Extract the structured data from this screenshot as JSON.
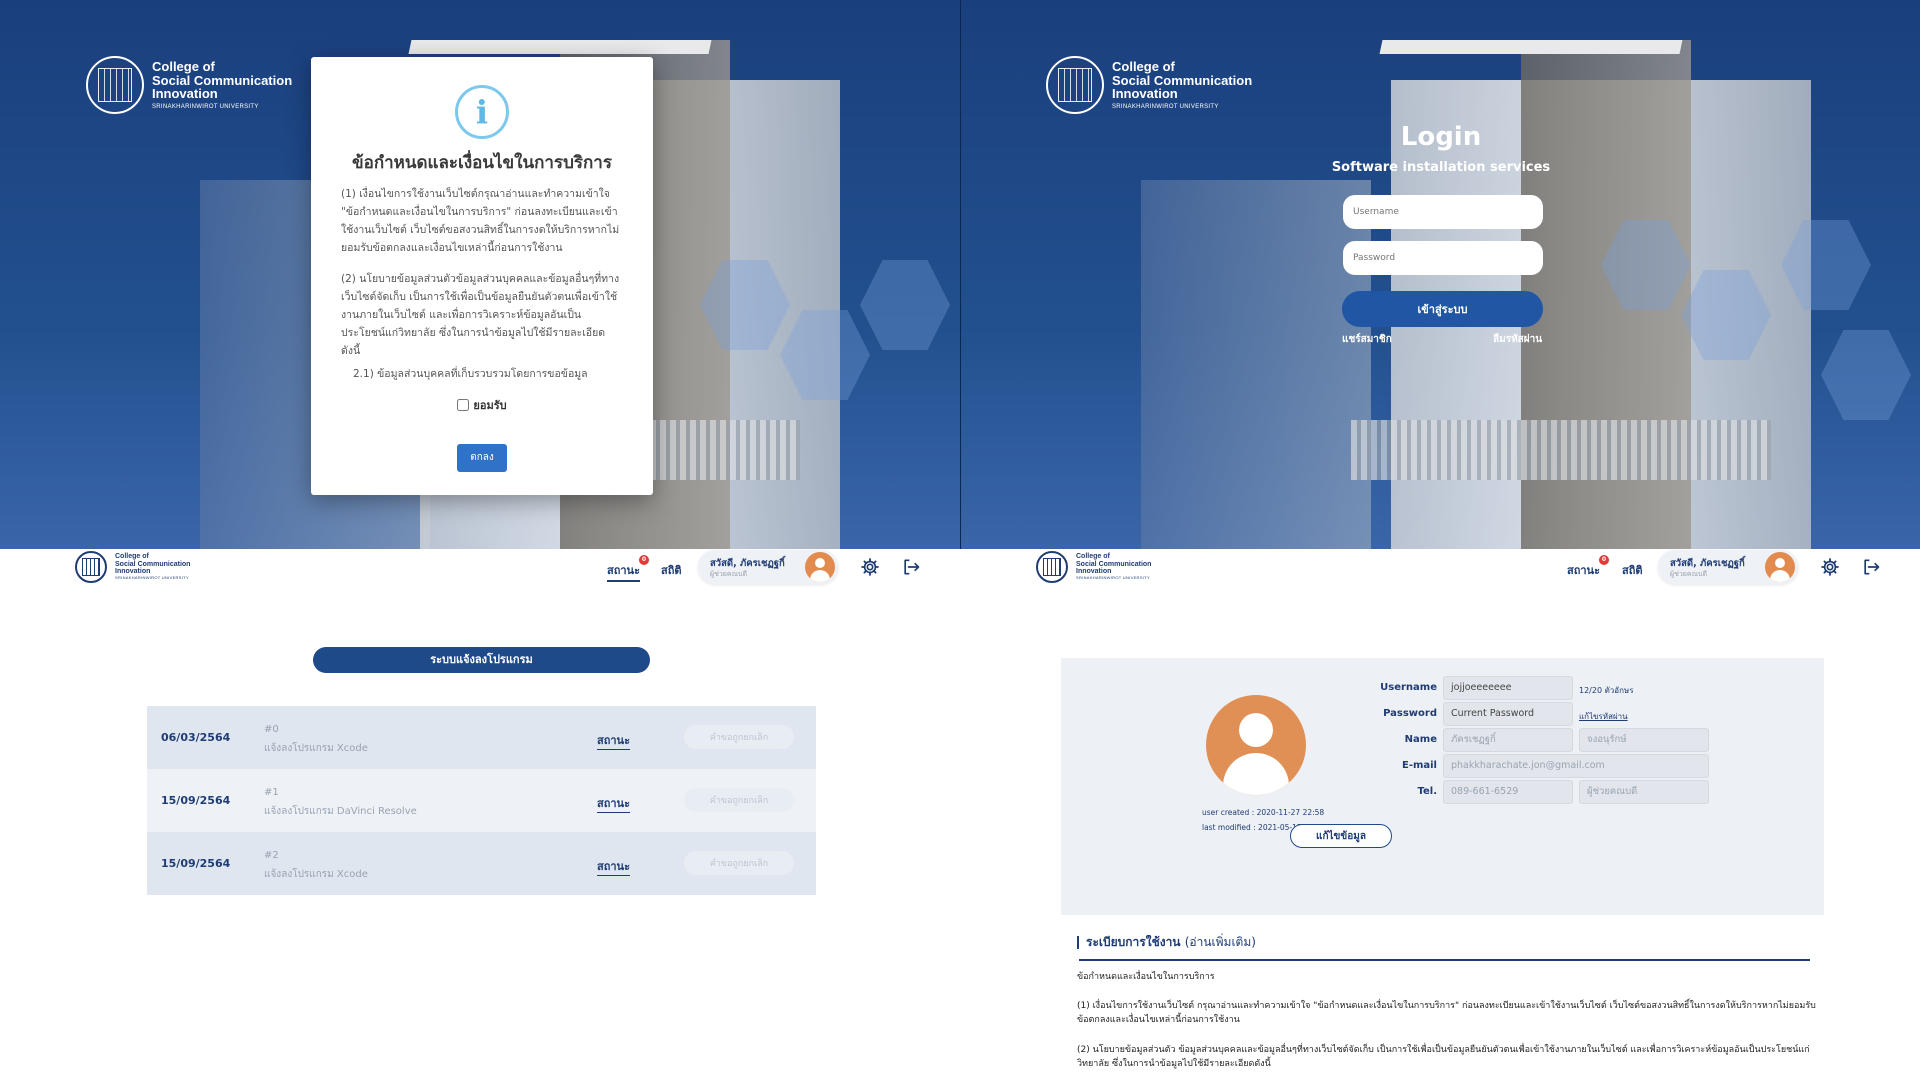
{
  "logo": {
    "title_line1": "College of",
    "title_line2": "Social Communication",
    "title_line3": "Innovation",
    "university": "SRINAKHARINWIROT UNIVERSITY"
  },
  "terms_modal": {
    "title": "ข้อกำหนดและเงื่อนไขในการบริการ",
    "para1": "(1)    เงื่อนไขการใช้งานเว็บไซต์กรุณาอ่านและทำความเข้าใจ \"ข้อกำหนดและเงื่อนไขในการบริการ\" ก่อนลงทะเบียนและเข้าใช้งานเว็บไซต์ เว็บไซต์ขอสงวนสิทธิ์ในการงดให้บริการหากไม่ยอมรับข้อตกลงและเงื่อนไขเหล่านี้ก่อนการใช้งาน",
    "para2": "(2)    นโยบายข้อมูลส่วนตัวข้อมูลส่วนบุคคลและข้อมูลอื่นๆที่ทางเว็บไซต์จัดเก็บ เป็นการใช้เพื่อเป็นข้อมูลยืนยันตัวตนเพื่อเข้าใช้งานภายในเว็บไซต์ และเพื่อการวิเคราะห์ข้อมูลอันเป็นประโยชน์แก่วิทยาลัย ซึ่งในการนำข้อมูลไปใช้มีรายละเอียดดังนี้",
    "para3": "2.1)    ข้อมูลส่วนบุคคลที่เก็บรวบรวมโดยการขอข้อมูล",
    "accept_label": "ยอมรับ",
    "ok_label": "ตกลง"
  },
  "login": {
    "title": "Login",
    "subtitle": "Software installation services",
    "username_placeholder": "Username",
    "password_placeholder": "Password",
    "submit_label": "เข้าสู่ระบบ",
    "register_link": "แชร์สมาชิก",
    "forgot_link": "ลืมรหัสผ่าน"
  },
  "navbar": {
    "status_label": "สถานะ",
    "status_badge": "0",
    "stats_label": "สถิติ",
    "user_name": "สวัสดี, ภัครเชฏฐกิ์",
    "user_role": "ผู้ช่วยคณบดี"
  },
  "requests": {
    "section_title": "ระบบแจ้งลงโปรแกรม",
    "status_label": "สถานะ",
    "cancel_label": "คำขอถูกยกเลิก",
    "rows": [
      {
        "date": "06/03/2564",
        "id": "#0",
        "desc": "แจ้งลงโปรแกรม Xcode"
      },
      {
        "date": "15/09/2564",
        "id": "#1",
        "desc": "แจ้งลงโปรแกรม DaVinci Resolve"
      },
      {
        "date": "15/09/2564",
        "id": "#2",
        "desc": "แจ้งลงโปรแกรม Xcode"
      }
    ]
  },
  "profile": {
    "user_created": "user created : 2020-11-27 22:58",
    "last_modified": "last modified : 2021-05-15 19:31",
    "username_label": "Username",
    "username_value": "jojjoeeeeeee",
    "username_count": "12/20 ตัวอักษร",
    "password_label": "Password",
    "password_placeholder": "Current Password",
    "password_link": "แก้ไขรหัสผ่าน",
    "name_label": "Name",
    "first_name": "ภัครเชฏฐกิ์",
    "last_name": "จงอนุรักษ์",
    "email_label": "E-mail",
    "email_value": "phakkharachate.jon@gmail.com",
    "tel_label": "Tel.",
    "tel_value": "089-661-6529",
    "position_value": "ผู้ช่วยคณบดี",
    "edit_label": "แก้ไขข้อมูล"
  },
  "rules": {
    "title": "ระเบียบการใช้งาน",
    "more": "(อ่านเพิ่มเติม)",
    "heading": "ข้อกำหนดและเงื่อนไขในการบริการ",
    "para1": "(1)    เงื่อนไขการใช้งานเว็บไซต์ กรุณาอ่านและทำความเข้าใจ \"ข้อกำหนดและเงื่อนไขในการบริการ\" ก่อนลงทะเบียนและเข้าใช้งานเว็บไซต์ เว็บไซต์ขอสงวนสิทธิ์ในการงดให้บริการหากไม่ยอมรับข้อตกลงและเงื่อนไขเหล่านี้ก่อนการใช้งาน",
    "para2": "(2)    นโยบายข้อมูลส่วนตัว ข้อมูลส่วนบุคคลและข้อมูลอื่นๆที่ทางเว็บไซต์จัดเก็บ เป็นการใช้เพื่อเป็นข้อมูลยืนยันตัวตนเพื่อเข้าใช้งานภายในเว็บไซต์ และเพื่อการวิเคราะห์ข้อมูลอันเป็นประโยชน์แก่วิทยาลัย ซึ่งในการนำข้อมูลไปใช้มีรายละเอียดดังนี้"
  },
  "colors": {
    "primary": "#1f4a8a",
    "background_blue": "#163f80",
    "badge": "#e03a3a",
    "avatar": "#e08f55"
  },
  "icons": [
    "info-icon",
    "gear-icon",
    "logout-icon",
    "avatar-icon",
    "college-seal-icon"
  ]
}
